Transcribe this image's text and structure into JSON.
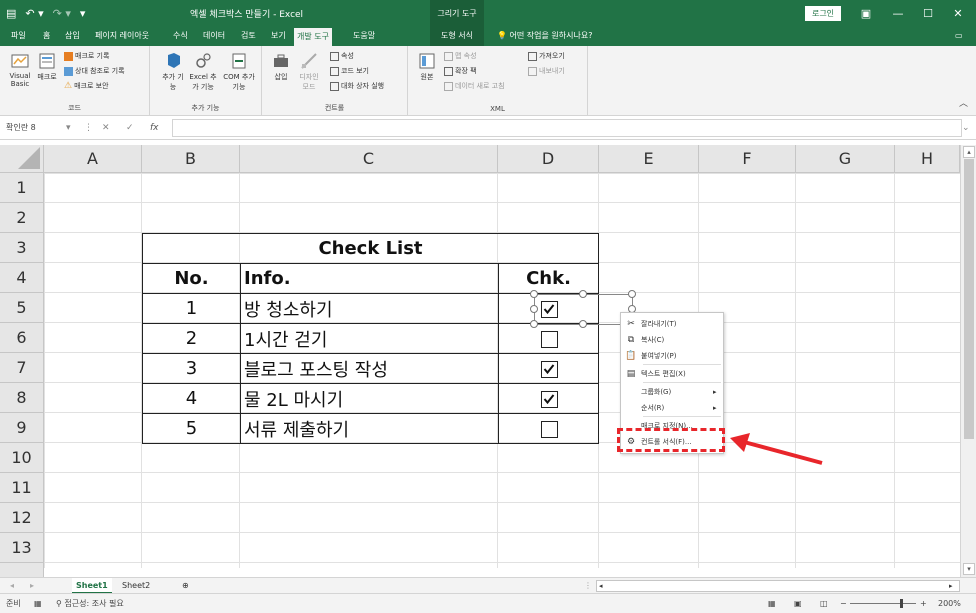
{
  "title_bar": {
    "title": "엑셀 체크박스 만들기 - Excel",
    "context_tab": "그리기 도구",
    "login_label": "로그인"
  },
  "tabs": [
    {
      "label": "파일"
    },
    {
      "label": "홈"
    },
    {
      "label": "삽입"
    },
    {
      "label": "페이지 레이아웃"
    },
    {
      "label": "수식"
    },
    {
      "label": "데이터"
    },
    {
      "label": "검토"
    },
    {
      "label": "보기"
    },
    {
      "label": "개발 도구"
    },
    {
      "label": "도움말"
    },
    {
      "label": "도형 서식"
    }
  ],
  "tell_me": "어떤 작업을 원하시나요?",
  "ribbon": {
    "code": {
      "group_label": "코드",
      "visual_basic": "Visual Basic",
      "macro": "매크로",
      "record_macro": "매크로 기록",
      "relative_ref": "상대 참조로 기록",
      "macro_security": "매크로 보안"
    },
    "addins": {
      "group_label": "추가 기능",
      "add": "추가 기능",
      "excel_addins": "Excel 추가 기능",
      "com_addins": "COM 추가 기능"
    },
    "controls": {
      "group_label": "컨트롤",
      "insert": "삽입",
      "design_mode": "디자인 모드",
      "properties": "속성",
      "view_code": "코드 보기",
      "run_dialog": "대화 상자 실행"
    },
    "xml": {
      "group_label": "XML",
      "source": "원본",
      "map_properties": "맵 속성",
      "expansion_packs": "확장 팩",
      "refresh_data": "데이터 새로 고침",
      "import": "가져오기",
      "export": "내보내기"
    }
  },
  "formula_bar": {
    "name_box": "확인란 8",
    "fx": "fx"
  },
  "columns": [
    "A",
    "B",
    "C",
    "D",
    "E",
    "F",
    "G",
    "H"
  ],
  "rows": [
    "1",
    "2",
    "3",
    "4",
    "5",
    "6",
    "7",
    "8",
    "9",
    "10",
    "11",
    "12",
    "13"
  ],
  "checklist": {
    "title": "Check List",
    "headers": {
      "no": "No.",
      "info": "Info.",
      "chk": "Chk."
    },
    "items": [
      {
        "no": "1",
        "info": "방 청소하기",
        "checked": true
      },
      {
        "no": "2",
        "info": "1시간 걷기",
        "checked": false
      },
      {
        "no": "3",
        "info": "블로그 포스팅 작성",
        "checked": true
      },
      {
        "no": "4",
        "info": "물 2L 마시기",
        "checked": true
      },
      {
        "no": "5",
        "info": "서류 제출하기",
        "checked": false
      }
    ]
  },
  "context_menu": {
    "cut": "잘라내기(T)",
    "copy": "복사(C)",
    "paste": "붙여넣기(P)",
    "edit_text": "텍스트 편집(X)",
    "group": "그룹화(G)",
    "order": "순서(R)",
    "assign_macro": "매크로 지정(N)...",
    "format_control": "컨트롤 서식(F)..."
  },
  "sheets": [
    "Sheet1",
    "Sheet2"
  ],
  "status_bar": {
    "ready": "준비",
    "accessibility": "접근성: 조사 필요",
    "zoom": "200%"
  },
  "colors": {
    "excel_green": "#217346",
    "highlight_red": "#e8262b"
  }
}
